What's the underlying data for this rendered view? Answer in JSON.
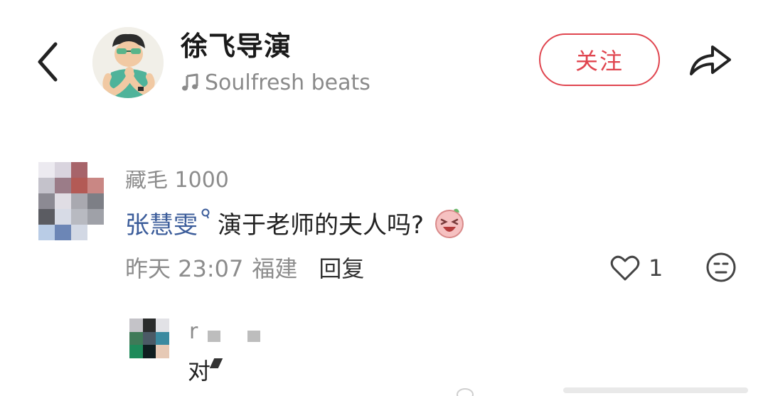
{
  "header": {
    "author_name": "徐飞导演",
    "music_text": "Soulfresh beats",
    "follow_label": "关注",
    "icons": {
      "back": "chevron-left-icon",
      "music": "music-note-icon",
      "share": "share-arrow-icon"
    }
  },
  "comments": [
    {
      "user_name_partial": "藏毛 1000",
      "mention": "张慧雯",
      "text": "演于老师的夫人吗?",
      "emoji": "laughing-face-emoji",
      "time": "昨天 23:07",
      "location": "福建",
      "reply_label": "回复",
      "like_count": "1",
      "icons": {
        "like": "heart-outline-icon",
        "dislike": "meh-face-icon"
      }
    },
    {
      "user_name_partial": "r",
      "text": "对"
    }
  ],
  "colors": {
    "accent": "#e0454f",
    "mention": "#3b5c9a",
    "meta": "#8c8c8c"
  }
}
